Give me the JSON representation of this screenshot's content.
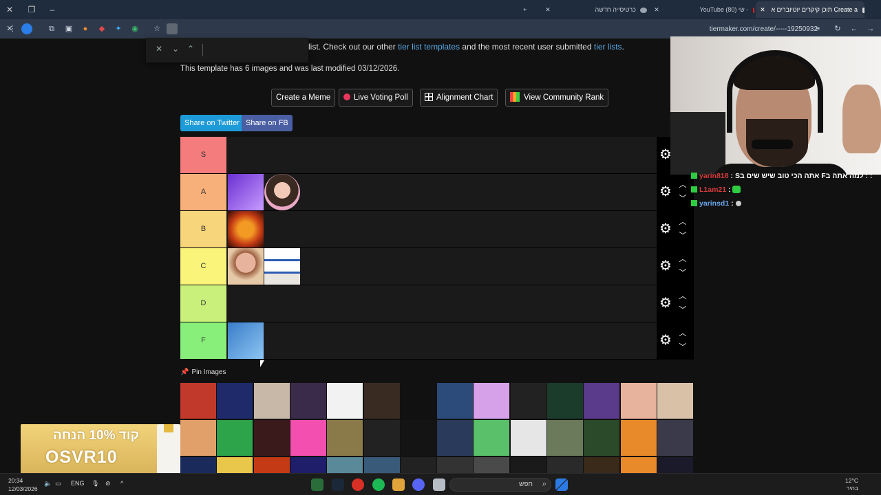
{
  "browser": {
    "tabs": [
      {
        "label": "תוכן קיקרים יוטיוברים א Create a",
        "active": true
      },
      {
        "label": "YouTube (80) שי -",
        "active": false
      },
      {
        "label": "כרטיסייה חדשה",
        "active": false
      }
    ],
    "url": "tiermaker.com/create/-----19250932",
    "new_tab_label": "+"
  },
  "page": {
    "intro_prefix": "list. Check out our other ",
    "intro_link1": "tier list templates",
    "intro_middle": " and the most recent user submitted ",
    "intro_link2": "tier lists",
    "intro_suffix": ".",
    "template_info": "This template has 6 images and was last modified 03/12/2026.",
    "actions": {
      "create_meme": "Create a Meme",
      "live_voting": "Live Voting Poll",
      "alignment": "Alignment Chart",
      "community_rank": "View Community Rank"
    },
    "share": {
      "twitter": "Share on Twitter",
      "fb": "Share on FB"
    },
    "tiers": [
      {
        "label": "S",
        "color": "#f47c7c",
        "items": []
      },
      {
        "label": "A",
        "color": "#f7b07a",
        "items": [
          "purple-avatar",
          "woman-avatar"
        ]
      },
      {
        "label": "B",
        "color": "#f7d57a",
        "items": [
          "tiger-avatar"
        ]
      },
      {
        "label": "C",
        "color": "#faf47a",
        "items": [
          "bald-man-avatar",
          "israel-flag-avatar"
        ]
      },
      {
        "label": "D",
        "color": "#c9f07a",
        "items": []
      },
      {
        "label": "F",
        "color": "#88f07a",
        "items": [
          "cartoon-avatar"
        ]
      }
    ],
    "pin_label": "Pin Images"
  },
  "chat": [
    {
      "user": "yarin818",
      "user_color": "#d63b3b",
      "msg": "Sאתה הכי טוב שיש שים ב Fלמה אתה ב : :"
    },
    {
      "user": "L1am21",
      "user_color": "#d63b3b",
      "msg": ""
    },
    {
      "user": "yarinsd1",
      "user_color": "#6aa8f0",
      "msg": ""
    }
  ],
  "ad": {
    "line1": "קוד 10% הנחה",
    "line2": "OSVR10"
  },
  "taskbar": {
    "time": "20:34",
    "date": "12/03/2026",
    "lang": "ENG",
    "search_placeholder": "חפש",
    "temp": "12°C",
    "weather": "בהיר"
  }
}
